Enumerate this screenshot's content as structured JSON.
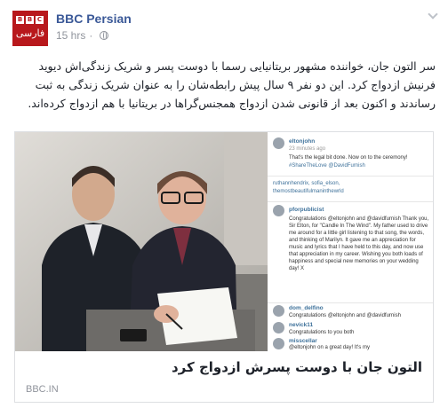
{
  "post": {
    "page_name": "BBC Persian",
    "time": "15 hrs",
    "separator": "·",
    "status_text": "سر التون جان، خواننده مشهور بریتانیایی رسما با دوست پسر و شریک زندگی‌اش دیوید فرنیش ازدواج کرد. این دو نفر ۹ سال پیش رابطه‌شان را به عنوان شریک زندگی به ثبت رساندند و اکنون بعد از قانونی شدن ازدواج همجنس‌گراها در بریتانیا با هم ازدواج کرده‌اند.",
    "avatar": {
      "bbc_letters": [
        "B",
        "B",
        "C"
      ],
      "subtitle": "فارسی"
    }
  },
  "card": {
    "title": "التون جان با دوست پسرش ازدواج کرد",
    "domain": "BBC.IN"
  },
  "instagram": {
    "c1_user": "eltonjohn",
    "c1_time": "23 minutes ago",
    "c1_text": "That's the legal bit done. Now on to the ceremony!",
    "c1_tags": "#ShareTheLove @DavidFurnish",
    "c2_users": "ruthannhendrix, sofia_elson,",
    "c2_more": "themostbeautifulmaninthewrld",
    "c3_user": "pforpublicist",
    "c3_text": "Congratulations @eltonjohn and @davidfurnish Thank you, Sir Elton, for \"Candle In The Wind\". My father used to drive me around for a little girl listening to that song, the words, and thinking of Marilyn. It gave me an appreciation for music and lyrics that I have held to this day, and now use that appreciation in my career. Wishing you both loads of happiness and special new memories on your wedding day! X",
    "c4_user": "dom_delfino",
    "c4_text": "Congratulations @eltonjohn and @davidfurnish",
    "c5_user": "nevick11",
    "c5_text": "Congratulations to you both",
    "c6_user": "misscellar",
    "c6_text": "@eltonjohn on a great day! It's my"
  },
  "colors": {
    "brand": "#b8181c",
    "link": "#3b5998",
    "meta": "#90949c"
  },
  "icons": [
    "globe-icon",
    "chevron-down-icon"
  ]
}
